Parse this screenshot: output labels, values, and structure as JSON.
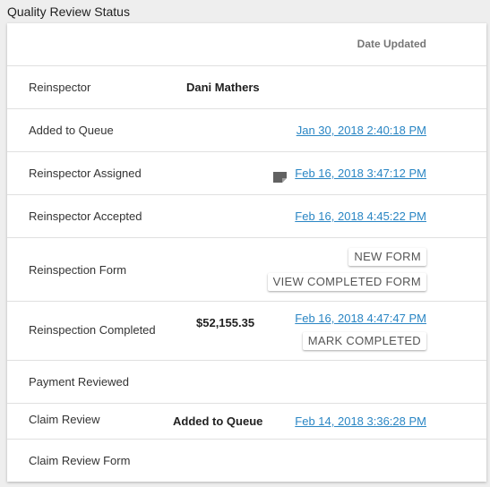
{
  "section_title": "Quality Review Status",
  "header": {
    "date_updated_label": "Date Updated"
  },
  "rows": [
    {
      "label": "Reinspector",
      "value": "Dani Mathers",
      "date": ""
    },
    {
      "label": "Added to Queue",
      "value": "",
      "date": "Jan 30, 2018 2:40:18 PM"
    },
    {
      "label": "Reinspector Assigned",
      "value": "",
      "icon": "note-icon",
      "date": "Feb 16, 2018 3:47:12 PM"
    },
    {
      "label": "Reinspector Accepted",
      "value": "",
      "date": "Feb 16, 2018 4:45:22 PM"
    },
    {
      "label": "Reinspection Form",
      "buttons": [
        "NEW FORM",
        "VIEW COMPLETED FORM"
      ]
    },
    {
      "label": "Reinspection Completed",
      "value": "$52,155.35",
      "date": "Feb 16, 2018 4:47:47 PM",
      "button": "MARK COMPLETED"
    },
    {
      "label": "Payment Reviewed"
    },
    {
      "label": "Claim Review",
      "value": "Added to Queue",
      "date": "Feb 14, 2018 3:36:28 PM"
    },
    {
      "label": "Claim Review Form"
    }
  ],
  "colors": {
    "link": "#2a86c4",
    "background": "#eeeeee",
    "card": "#ffffff"
  }
}
